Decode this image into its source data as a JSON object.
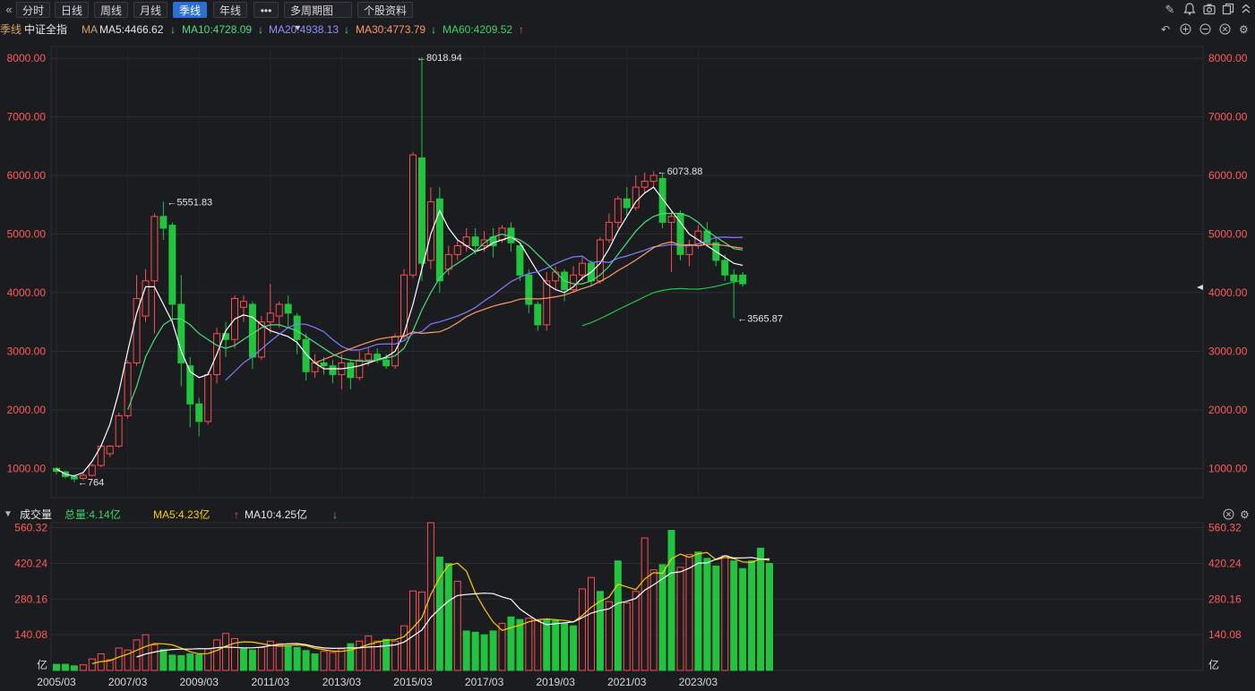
{
  "toolbar": {
    "back_icon": "double-chevron-left-icon",
    "tabs": [
      "分时",
      "日线",
      "周线",
      "月线",
      "季线",
      "年线"
    ],
    "active_tab": "季线",
    "more_label": "•••",
    "multi_period_label": "多周期图",
    "stock_info_label": "个股资料",
    "right_icons": [
      "pencil-icon",
      "bell-icon",
      "camera-icon",
      "copy-icon",
      "chevron-up-icon"
    ]
  },
  "ma_bar": {
    "period": "季线",
    "index_name": "中证全指",
    "ma_label": "MA",
    "ma5": "MA5:4466.62",
    "ma10": "MA10:4728.09",
    "ma20": "MA20:4938.13",
    "ma30": "MA30:4773.79",
    "ma60": "MA60:4209.52",
    "tool_icons": [
      "undo-icon",
      "zoom-in-icon",
      "zoom-out-icon",
      "close-icon",
      "settings-icon"
    ]
  },
  "volume_bar": {
    "title": "成交量",
    "total": "总量:4.14亿",
    "ma5": "MA5:4.23亿",
    "ma10": "MA10:4.25亿",
    "tool_icons": [
      "close-icon",
      "settings-icon"
    ]
  },
  "colors": {
    "up": "#ff4d4f",
    "down": "#22c33f",
    "ma5": "#ffffff",
    "ma10": "#4ade80",
    "ma20": "#7f7fff",
    "ma30": "#ff9966",
    "ma60": "#22c33f",
    "vol_ma5": "#ffcc00",
    "vol_ma10": "#ffffff",
    "axis_red": "#ff5b5b"
  },
  "chart_data": {
    "type": "candlestick",
    "price_ylim": [
      500,
      8200
    ],
    "price_ticks": [
      "8000.00",
      "7000.00",
      "6000.00",
      "5000.00",
      "4000.00",
      "3000.00",
      "2000.00",
      "1000.00"
    ],
    "volume_ylim": [
      0,
      580
    ],
    "volume_ticks": [
      "560.32",
      "420.24",
      "280.16",
      "140.08"
    ],
    "volume_unit": "亿",
    "x_labels": [
      "2005/03",
      "2007/03",
      "2009/03",
      "2011/03",
      "2013/03",
      "2015/03",
      "2017/03",
      "2019/03",
      "2021/03",
      "2023/03"
    ],
    "annotations": [
      {
        "label": "8018.94",
        "value": 8018.94,
        "index": 40
      },
      {
        "label": "5551.83",
        "value": 5551.83,
        "index": 12
      },
      {
        "label": "6073.88",
        "value": 6073.88,
        "index": 67
      },
      {
        "label": "3565.87",
        "value": 3565.87,
        "index": 76
      },
      {
        "label": "764",
        "value": 764,
        "index": 2
      }
    ],
    "candles": [
      [
        1000,
        950,
        1020,
        900
      ],
      [
        940,
        860,
        960,
        830
      ],
      [
        860,
        820,
        900,
        764
      ],
      [
        830,
        880,
        920,
        800
      ],
      [
        880,
        1050,
        1080,
        860
      ],
      [
        1050,
        1380,
        1400,
        1020
      ],
      [
        1250,
        1380,
        1400,
        1200
      ],
      [
        1380,
        1900,
        1950,
        1350
      ],
      [
        1900,
        2800,
        2850,
        1850
      ],
      [
        2800,
        3900,
        4300,
        2750
      ],
      [
        3600,
        4200,
        4400,
        3500
      ],
      [
        4200,
        5300,
        5350,
        3300
      ],
      [
        5300,
        5100,
        5551.83,
        4900
      ],
      [
        5150,
        3800,
        5200,
        3500
      ],
      [
        3800,
        2800,
        4300,
        2400
      ],
      [
        2750,
        2100,
        2900,
        1700
      ],
      [
        2100,
        1800,
        2200,
        1550
      ],
      [
        1800,
        2600,
        2650,
        1750
      ],
      [
        2600,
        3300,
        3400,
        2450
      ],
      [
        3300,
        3200,
        3500,
        2900
      ],
      [
        3200,
        3900,
        3950,
        3050
      ],
      [
        3750,
        3850,
        3950,
        3500
      ],
      [
        3800,
        2900,
        3850,
        2700
      ],
      [
        2900,
        3500,
        3600,
        2850
      ],
      [
        3500,
        3650,
        4150,
        3300
      ],
      [
        3600,
        3800,
        3850,
        3400
      ],
      [
        3800,
        3650,
        3950,
        3400
      ],
      [
        3600,
        3200,
        3650,
        2950
      ],
      [
        3200,
        2650,
        3300,
        2500
      ],
      [
        2650,
        2800,
        2950,
        2550
      ],
      [
        2800,
        2750,
        2900,
        2600
      ],
      [
        2750,
        2600,
        2850,
        2450
      ],
      [
        2600,
        2800,
        2950,
        2350
      ],
      [
        2800,
        2550,
        2850,
        2350
      ],
      [
        2550,
        2850,
        3000,
        2500
      ],
      [
        2850,
        2950,
        3050,
        2750
      ],
      [
        2950,
        2850,
        3050,
        2800
      ],
      [
        2850,
        2750,
        2950,
        2700
      ],
      [
        2750,
        3250,
        3300,
        2700
      ],
      [
        3250,
        4300,
        4400,
        3200
      ],
      [
        4300,
        6350,
        6400,
        4250
      ],
      [
        6300,
        4500,
        8018.94,
        4200
      ],
      [
        4550,
        5550,
        5800,
        4400
      ],
      [
        5600,
        4200,
        5800,
        4000
      ],
      [
        4400,
        4650,
        4800,
        4300
      ],
      [
        4650,
        4800,
        4900,
        4550
      ],
      [
        4800,
        4950,
        5100,
        4700
      ],
      [
        4950,
        4800,
        5100,
        4650
      ],
      [
        4800,
        4900,
        5050,
        4700
      ],
      [
        4950,
        4800,
        5100,
        4600
      ],
      [
        4900,
        5100,
        5150,
        4850
      ],
      [
        5100,
        4850,
        5200,
        4700
      ],
      [
        4800,
        4300,
        4850,
        4200
      ],
      [
        4300,
        3800,
        4400,
        3650
      ],
      [
        3800,
        3450,
        3850,
        3350
      ],
      [
        3450,
        4200,
        4350,
        3350
      ],
      [
        4200,
        4350,
        4450,
        4050
      ],
      [
        4350,
        4050,
        4400,
        3850
      ],
      [
        4050,
        4300,
        4450,
        4000
      ],
      [
        4300,
        4500,
        4600,
        4200
      ],
      [
        4500,
        4200,
        4550,
        4100
      ],
      [
        4200,
        4900,
        4950,
        4150
      ],
      [
        4900,
        5200,
        5350,
        4850
      ],
      [
        5200,
        5600,
        5650,
        5100
      ],
      [
        5600,
        5450,
        5800,
        5300
      ],
      [
        5450,
        5800,
        6000,
        5400
      ],
      [
        5800,
        5900,
        6050,
        5700
      ],
      [
        5900,
        6000,
        6073.88,
        5800
      ],
      [
        5950,
        5200,
        6050,
        5100
      ],
      [
        5200,
        5300,
        5400,
        4350
      ],
      [
        5350,
        4650,
        5400,
        4550
      ],
      [
        4650,
        4800,
        4900,
        4450
      ],
      [
        4800,
        5050,
        5150,
        4750
      ],
      [
        5050,
        4850,
        5200,
        4800
      ],
      [
        4850,
        4550,
        4950,
        4450
      ],
      [
        4550,
        4300,
        4650,
        4200
      ],
      [
        4300,
        4200,
        4400,
        3565.87
      ],
      [
        4300,
        4150,
        4350,
        4100
      ]
    ],
    "volume": [
      [
        24,
        0
      ],
      [
        24,
        0
      ],
      [
        18,
        0
      ],
      [
        22,
        1
      ],
      [
        45,
        1
      ],
      [
        65,
        1
      ],
      [
        42,
        1
      ],
      [
        88,
        1
      ],
      [
        80,
        1
      ],
      [
        120,
        1
      ],
      [
        140,
        1
      ],
      [
        100,
        1
      ],
      [
        82,
        0
      ],
      [
        60,
        0
      ],
      [
        58,
        0
      ],
      [
        65,
        0
      ],
      [
        62,
        0
      ],
      [
        85,
        1
      ],
      [
        120,
        1
      ],
      [
        145,
        1
      ],
      [
        125,
        1
      ],
      [
        85,
        0
      ],
      [
        80,
        0
      ],
      [
        90,
        1
      ],
      [
        115,
        1
      ],
      [
        105,
        1
      ],
      [
        98,
        0
      ],
      [
        90,
        0
      ],
      [
        78,
        0
      ],
      [
        65,
        0
      ],
      [
        75,
        1
      ],
      [
        70,
        1
      ],
      [
        85,
        1
      ],
      [
        105,
        0
      ],
      [
        115,
        1
      ],
      [
        135,
        1
      ],
      [
        115,
        1
      ],
      [
        122,
        0
      ],
      [
        115,
        1
      ],
      [
        175,
        1
      ],
      [
        312,
        1
      ],
      [
        308,
        1
      ],
      [
        580,
        1
      ],
      [
        445,
        0
      ],
      [
        420,
        0
      ],
      [
        350,
        1
      ],
      [
        155,
        0
      ],
      [
        150,
        0
      ],
      [
        140,
        0
      ],
      [
        155,
        0
      ],
      [
        185,
        1
      ],
      [
        210,
        0
      ],
      [
        200,
        0
      ],
      [
        205,
        1
      ],
      [
        195,
        1
      ],
      [
        200,
        0
      ],
      [
        195,
        0
      ],
      [
        185,
        0
      ],
      [
        175,
        0
      ],
      [
        320,
        1
      ],
      [
        365,
        1
      ],
      [
        310,
        0
      ],
      [
        270,
        1
      ],
      [
        430,
        0
      ],
      [
        265,
        1
      ],
      [
        310,
        1
      ],
      [
        520,
        1
      ],
      [
        395,
        1
      ],
      [
        415,
        0
      ],
      [
        550,
        0
      ],
      [
        405,
        1
      ],
      [
        455,
        1
      ],
      [
        465,
        0
      ],
      [
        440,
        0
      ],
      [
        410,
        0
      ],
      [
        450,
        1
      ],
      [
        430,
        0
      ],
      [
        400,
        0
      ],
      [
        430,
        0
      ],
      [
        480,
        0
      ],
      [
        420,
        0
      ]
    ],
    "ma5_price": [
      990,
      900,
      870,
      930,
      1120,
      1380,
      1750,
      2300,
      3000,
      3650,
      4100,
      4100,
      3800,
      3500,
      3000,
      2650,
      2550,
      2600,
      2950,
      3350,
      3550,
      3620,
      3580,
      3450,
      3350,
      3300,
      3250,
      3150,
      2950,
      2800,
      2700,
      2700,
      2700,
      2720,
      2750,
      2800,
      2850,
      2900,
      3000,
      3300,
      3800,
      4400,
      5000,
      5400,
      5100,
      4900,
      4800,
      4700,
      4750,
      4850,
      4900,
      4950,
      4850,
      4600,
      4350,
      4150,
      4050,
      4000,
      4100,
      4250,
      4350,
      4500,
      4750,
      5050,
      5300,
      5550,
      5700,
      5800,
      5600,
      5400,
      5200,
      5000,
      4900,
      4800,
      4700,
      4600,
      4500,
      4466
    ],
    "ma10_price": [
      null,
      null,
      null,
      null,
      null,
      null,
      null,
      null,
      2000,
      2400,
      2900,
      3200,
      3450,
      3550,
      3550,
      3450,
      3300,
      3200,
      3100,
      3050,
      3100,
      3200,
      3300,
      3400,
      3450,
      3450,
      3400,
      3350,
      3250,
      3150,
      3050,
      2950,
      2880,
      2850,
      2830,
      2830,
      2850,
      2880,
      2920,
      3050,
      3350,
      3700,
      4000,
      4250,
      4400,
      4500,
      4600,
      4700,
      4850,
      4950,
      5000,
      4950,
      4900,
      4800,
      4650,
      4500,
      4350,
      4200,
      4150,
      4150,
      4200,
      4300,
      4450,
      4650,
      4850,
      5050,
      5200,
      5300,
      5350,
      5350,
      5350,
      5300,
      5200,
      5050,
      4950,
      4850,
      4750,
      4728
    ]
  }
}
